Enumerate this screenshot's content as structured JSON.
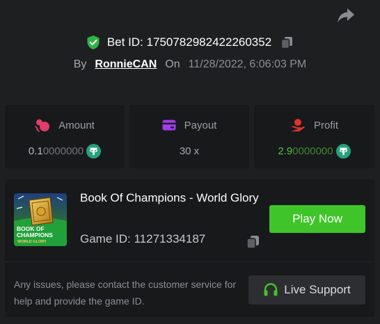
{
  "header": {
    "bet_id_label": "Bet ID:",
    "bet_id": "1750782982422260352",
    "by_label": "By",
    "username": "RonnieCAN",
    "on_label": "On",
    "datetime": "11/28/2022, 6:06:03 PM"
  },
  "stats": {
    "amount": {
      "label": "Amount",
      "value_strong": "0.1",
      "value_faint": "0000000",
      "icon": "coins-icon"
    },
    "payout": {
      "label": "Payout",
      "value": "30 x",
      "icon": "wallet-icon"
    },
    "profit": {
      "label": "Profit",
      "value_strong": "2.9",
      "value_faint": "0000000",
      "icon": "hand-coin-icon"
    },
    "currency_icon": "tether-usdt-icon"
  },
  "game": {
    "title": "Book Of Champions - World Glory",
    "id_label": "Game ID:",
    "id": "11271334187",
    "thumb_text_line1": "BOOK OF",
    "thumb_text_line2": "CHAMPIONS",
    "thumb_text_line3": "WORLD GLORY",
    "play_label": "Play Now"
  },
  "support": {
    "text": "Any issues, please contact the customer service for help and provide the game ID.",
    "button_label": "Live Support"
  },
  "colors": {
    "background": "#1e1f21",
    "card": "#18191b",
    "accent_green": "#3fc52a",
    "profit_green": "#56c23a",
    "shield_green": "#2fb344",
    "tether": "#26a17b"
  }
}
